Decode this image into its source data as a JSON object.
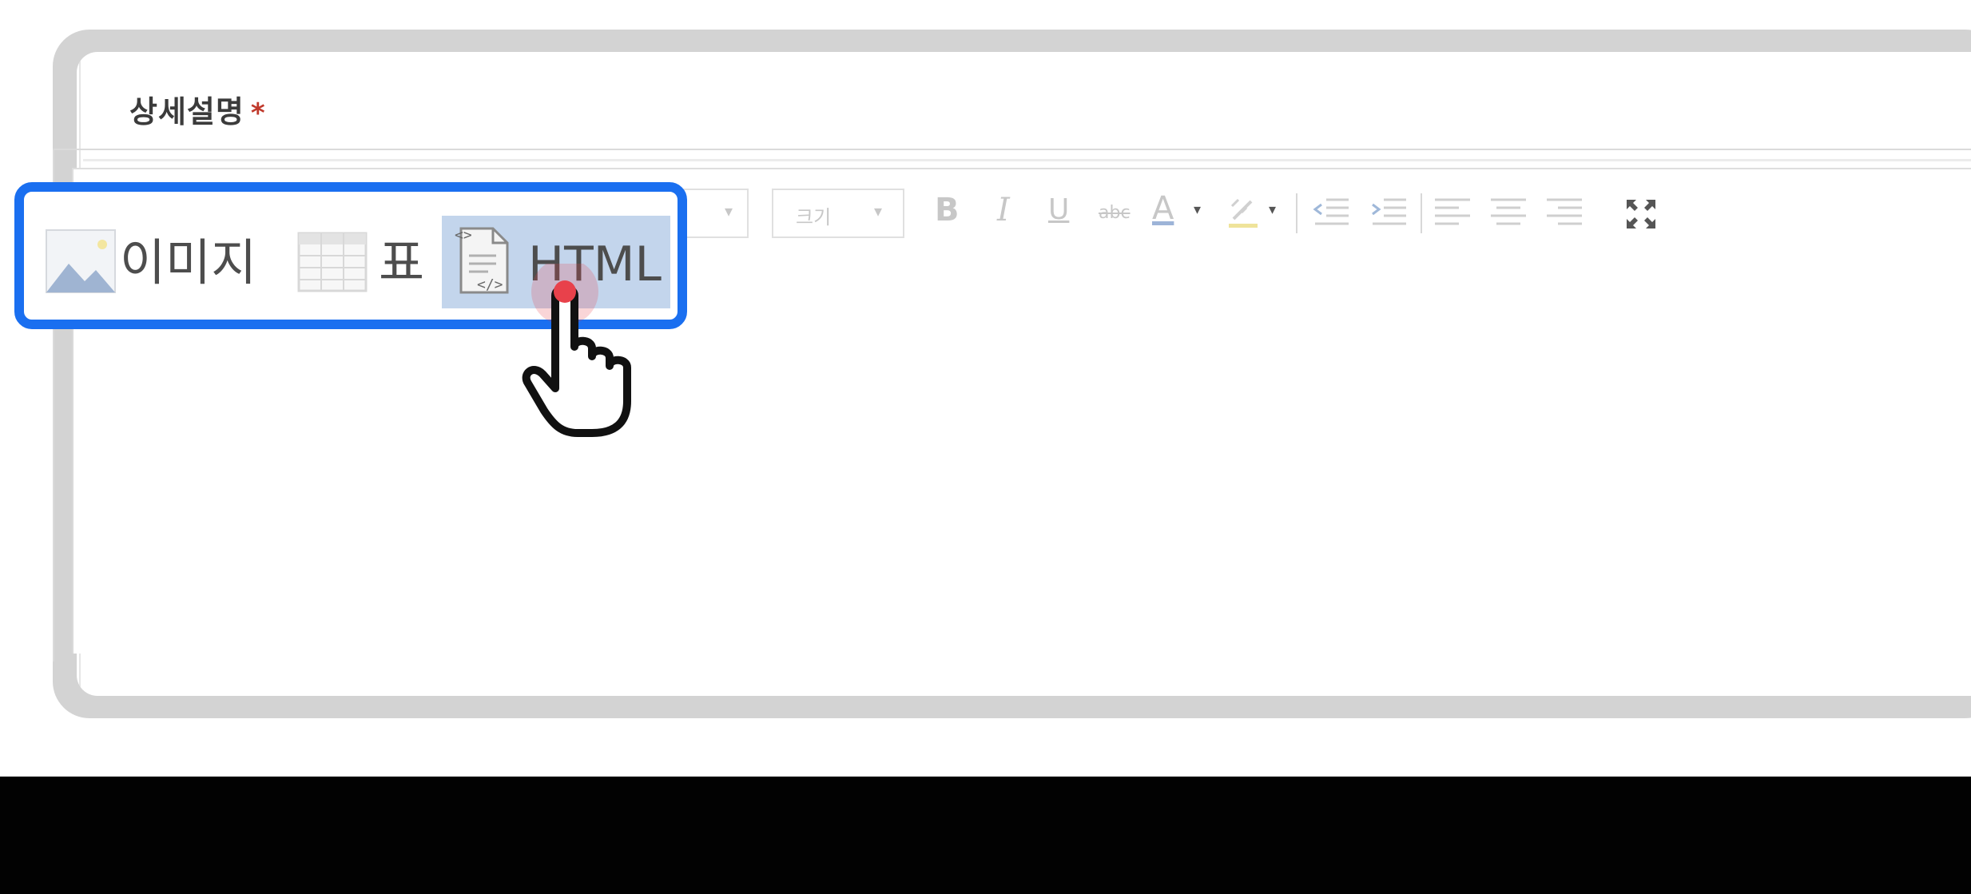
{
  "field": {
    "label": "상세설명",
    "required_mark": "*"
  },
  "toolbar": {
    "insert_image_label": "이미지",
    "insert_table_label": "표",
    "insert_html_label": "HTML",
    "size_select_placeholder": "크기",
    "bold_glyph": "B",
    "italic_glyph": "I",
    "underline_glyph": "U",
    "strike_glyph": "abc",
    "font_color_glyph": "A",
    "highlight_glyph": "ᵃ⁄"
  },
  "icons": {
    "image": "image-icon",
    "table": "table-icon",
    "html": "html-file-icon",
    "outdent": "outdent-icon",
    "indent": "indent-icon",
    "align_left": "align-left-icon",
    "align_center": "align-center-icon",
    "align_right": "align-right-icon",
    "fullscreen": "fullscreen-icon",
    "pointer": "hand-pointer-icon"
  },
  "colors": {
    "highlight_border": "#1a6ff0",
    "selected_button": "#c3d5ec",
    "required": "#c0392b",
    "click_dot": "#e8414b"
  }
}
